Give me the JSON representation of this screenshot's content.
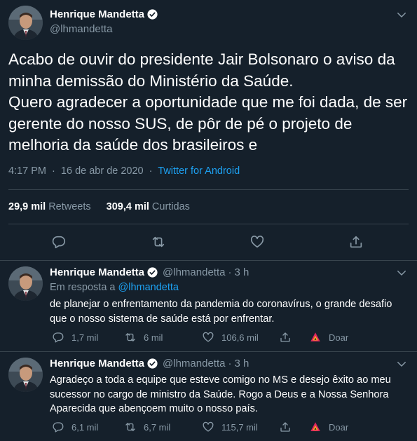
{
  "main_tweet": {
    "name": "Henrique Mandetta",
    "handle": "@lhmandetta",
    "text": "Acabo de ouvir do presidente Jair Bolsonaro o aviso da minha demissão do Ministério da Saúde.\nQuero agradecer a oportunidade que me foi dada, de ser gerente do nosso SUS, de pôr de pé o projeto de melhoria da saúde dos brasileiros e",
    "time": "4:17 PM",
    "date": "16 de abr de 2020",
    "separator": "·",
    "source": "Twitter for Android",
    "retweets_count": "29,9 mil",
    "retweets_label": "Retweets",
    "likes_count": "309,4 mil",
    "likes_label": "Curtidas"
  },
  "replies": [
    {
      "name": "Henrique Mandetta",
      "handle": "@lhmandetta",
      "dot": "·",
      "time": "3 h",
      "reply_to_label": "Em resposta a",
      "reply_to_handle": "@lhmandetta",
      "text": "de planejar o enfrentamento da pandemia do coronavírus, o grande desafio que o nosso sistema de saúde está por enfrentar.",
      "replies_count": "1,7 mil",
      "retweets_count": "6 mil",
      "likes_count": "106,6 mil",
      "donate_label": "Doar"
    },
    {
      "name": "Henrique Mandetta",
      "handle": "@lhmandetta",
      "dot": "·",
      "time": "3 h",
      "text": "Agradeço a toda a equipe que esteve comigo no MS e desejo êxito ao meu sucessor no cargo de ministro da Saúde. Rogo a Deus e a Nossa Senhora Aparecida que abençoem muito o nosso país.",
      "replies_count": "6,1 mil",
      "retweets_count": "6,7 mil",
      "likes_count": "115,7 mil",
      "donate_label": "Doar"
    }
  ],
  "icons": {
    "verified": "verified-badge-icon",
    "more": "chevron-down-icon",
    "reply": "reply-icon",
    "retweet": "retweet-icon",
    "like": "heart-icon",
    "share": "share-icon",
    "donate": "donate-icon"
  },
  "colors": {
    "background": "#15202b",
    "text": "#ffffff",
    "secondary": "#8899a6",
    "link": "#1da1f2",
    "divider": "#38444d",
    "donate_red": "#e0245e",
    "donate_yellow": "#ffad1f"
  }
}
